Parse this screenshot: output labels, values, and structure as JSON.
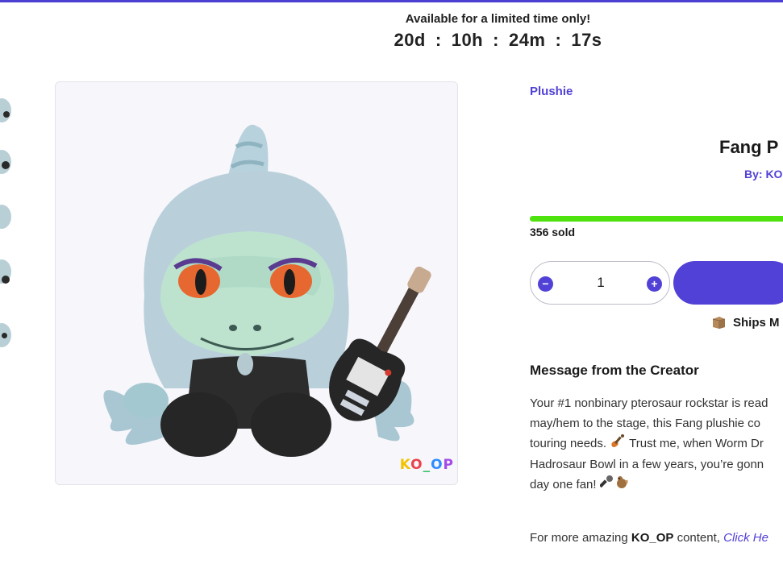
{
  "promo": {
    "title": "Available for a limited time only!",
    "days": "20d",
    "hours": "10h",
    "minutes": "24m",
    "seconds": "17s",
    "separator": ":"
  },
  "gallery": {
    "logo_letters": [
      "K",
      "O",
      "_",
      "O",
      "P"
    ],
    "thumbnail_count": 5
  },
  "product": {
    "category": "Plushie",
    "title_visible": "Fang P",
    "by_visible": "By: KO",
    "sold_count": "356",
    "sold_suffix": "sold",
    "sold_progress_fraction": 1.0,
    "quantity": "1",
    "ships_visible": "Ships M"
  },
  "message": {
    "heading": "Message from the Creator",
    "lines": [
      "Your #1 nonbinary pterosaur rockstar is read",
      "may/hem to the stage, this Fang plushie co",
      "touring needs.",
      "Trust me, when Worm Dr",
      "Hadrosaur Bowl in a few years, you’re gonn",
      "day one fan!"
    ]
  },
  "footer": {
    "prefix": "For more amazing",
    "brand": "KO_OP",
    "middle": "content,",
    "link": "Click He"
  },
  "colors": {
    "accent": "#5141d6",
    "progress": "#4ee20f",
    "topbar": "#4b3fd1"
  },
  "icons": {
    "minus": "−",
    "plus": "+",
    "ships": "package-icon",
    "guitar_emoji": "guitar-icon",
    "mic_emoji": "microphone-icon",
    "chipmunk_emoji": "chipmunk-icon"
  }
}
